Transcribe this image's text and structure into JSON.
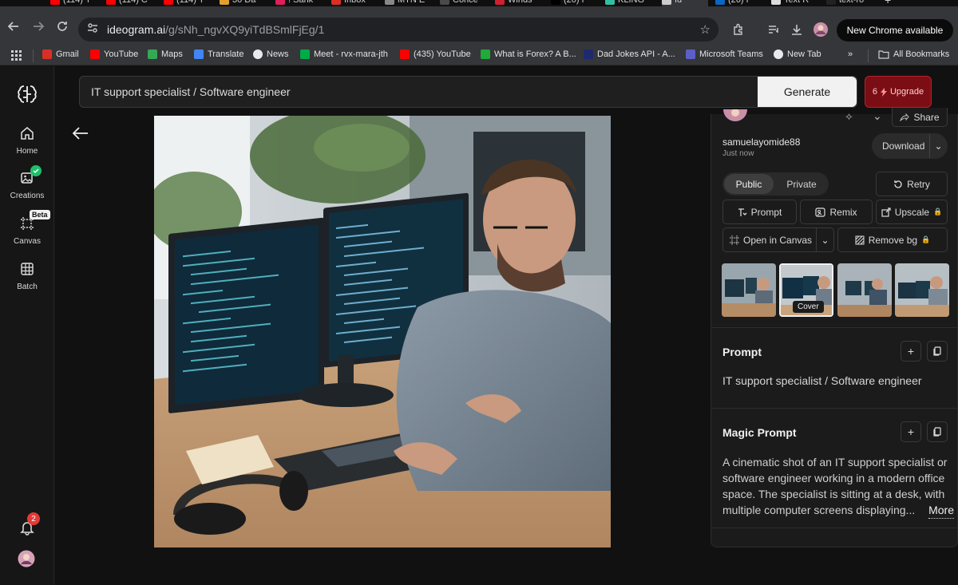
{
  "browser": {
    "tabs": [
      {
        "title": "(114) Y",
        "icon": "youtube-icon",
        "color": "#ff0000"
      },
      {
        "title": "(114) C",
        "icon": "youtube-icon",
        "color": "#ff0000"
      },
      {
        "title": "(114) Y",
        "icon": "youtube-icon",
        "color": "#ff0000"
      },
      {
        "title": "30 Da",
        "icon": "page-icon",
        "color": "#e0a030"
      },
      {
        "title": "! Sank",
        "icon": "slack-icon",
        "color": "#e01e5a"
      },
      {
        "title": "Inbox",
        "icon": "gmail-icon",
        "color": "#d93025"
      },
      {
        "title": "MTN E",
        "icon": "page-icon",
        "color": "#888888"
      },
      {
        "title": "Conce",
        "icon": "page-icon",
        "color": "#4a4a4a"
      },
      {
        "title": "Winds",
        "icon": "page-icon",
        "color": "#d02030"
      },
      {
        "title": "(20) F",
        "icon": "x-icon",
        "color": "#000000"
      },
      {
        "title": "KLING",
        "icon": "page-icon",
        "color": "#30c0a0"
      },
      {
        "title": "Id",
        "icon": "ideogram-icon",
        "color": "#cccccc",
        "active": true
      },
      {
        "title": "(26) F",
        "icon": "linkedin-icon",
        "color": "#0a66c2"
      },
      {
        "title": "Text R",
        "icon": "openai-icon",
        "color": "#dddddd"
      },
      {
        "title": "text-ro",
        "icon": "medium-icon",
        "color": "#222222"
      }
    ],
    "url_host": "ideogram.ai",
    "url_path": "/g/sNh_ngvXQ9yiTdBSmlFjEg/1",
    "new_chrome_label": "New Chrome available",
    "bookmarks": [
      {
        "label": "Gmail",
        "icon": "gmail-icon",
        "color": "#d93025"
      },
      {
        "label": "YouTube",
        "icon": "youtube-icon",
        "color": "#ff0000"
      },
      {
        "label": "Maps",
        "icon": "maps-icon",
        "color": "#34a853"
      },
      {
        "label": "Translate",
        "icon": "translate-icon",
        "color": "#4285f4"
      },
      {
        "label": "News",
        "icon": "news-icon",
        "color": "#e8eaed"
      },
      {
        "label": "Meet - rvx-mara-jth",
        "icon": "meet-icon",
        "color": "#00ac47"
      },
      {
        "label": "(435) YouTube",
        "icon": "youtube-icon",
        "color": "#ff0000"
      },
      {
        "label": "What is Forex? A B...",
        "icon": "page-icon",
        "color": "#1faa3a"
      },
      {
        "label": "Dad Jokes API - A...",
        "icon": "page-icon",
        "color": "#1f2a6e"
      },
      {
        "label": "Microsoft Teams",
        "icon": "teams-icon",
        "color": "#5b5fc7"
      },
      {
        "label": "New Tab",
        "icon": "chrome-icon",
        "color": "#e8eaed"
      }
    ],
    "more_bookmarks": "»",
    "all_bookmarks_label": "All Bookmarks"
  },
  "sidebar": {
    "items": [
      {
        "label": "Home",
        "icon": "home-icon"
      },
      {
        "label": "Creations",
        "icon": "image-icon"
      },
      {
        "label": "Canvas",
        "icon": "canvas-icon",
        "badge": "Beta"
      },
      {
        "label": "Batch",
        "icon": "batch-icon"
      }
    ],
    "notification_count": "2"
  },
  "main": {
    "prompt_input": "IT support specialist / Software engineer",
    "generate_label": "Generate",
    "upgrade_count": "6",
    "upgrade_label": "Upgrade"
  },
  "panel": {
    "share_label": "Share",
    "username": "samuelayomide88",
    "timestamp": "Just now",
    "download_label": "Download",
    "visibility": {
      "public": "Public",
      "private": "Private",
      "selected": "Public"
    },
    "retry_label": "Retry",
    "prompt_btn": "Prompt",
    "remix_btn": "Remix",
    "upscale_btn": "Upscale",
    "open_canvas_btn": "Open in Canvas",
    "remove_bg_btn": "Remove bg",
    "cover_label": "Cover",
    "prompt_section": {
      "title": "Prompt",
      "text": "IT support specialist / Software engineer"
    },
    "magic_prompt_section": {
      "title": "Magic Prompt",
      "line1": "A cinematic shot of an IT support specialist or",
      "line2": "software engineer working in a modern office",
      "line3": "space. The specialist is sitting at a desk, with",
      "line4": "multiple computer screens displaying...",
      "more_label": "More"
    }
  },
  "colors": {
    "accent_green": "#1fbf6b",
    "upgrade_red": "#7a0e14",
    "notification_red": "#e53935"
  }
}
